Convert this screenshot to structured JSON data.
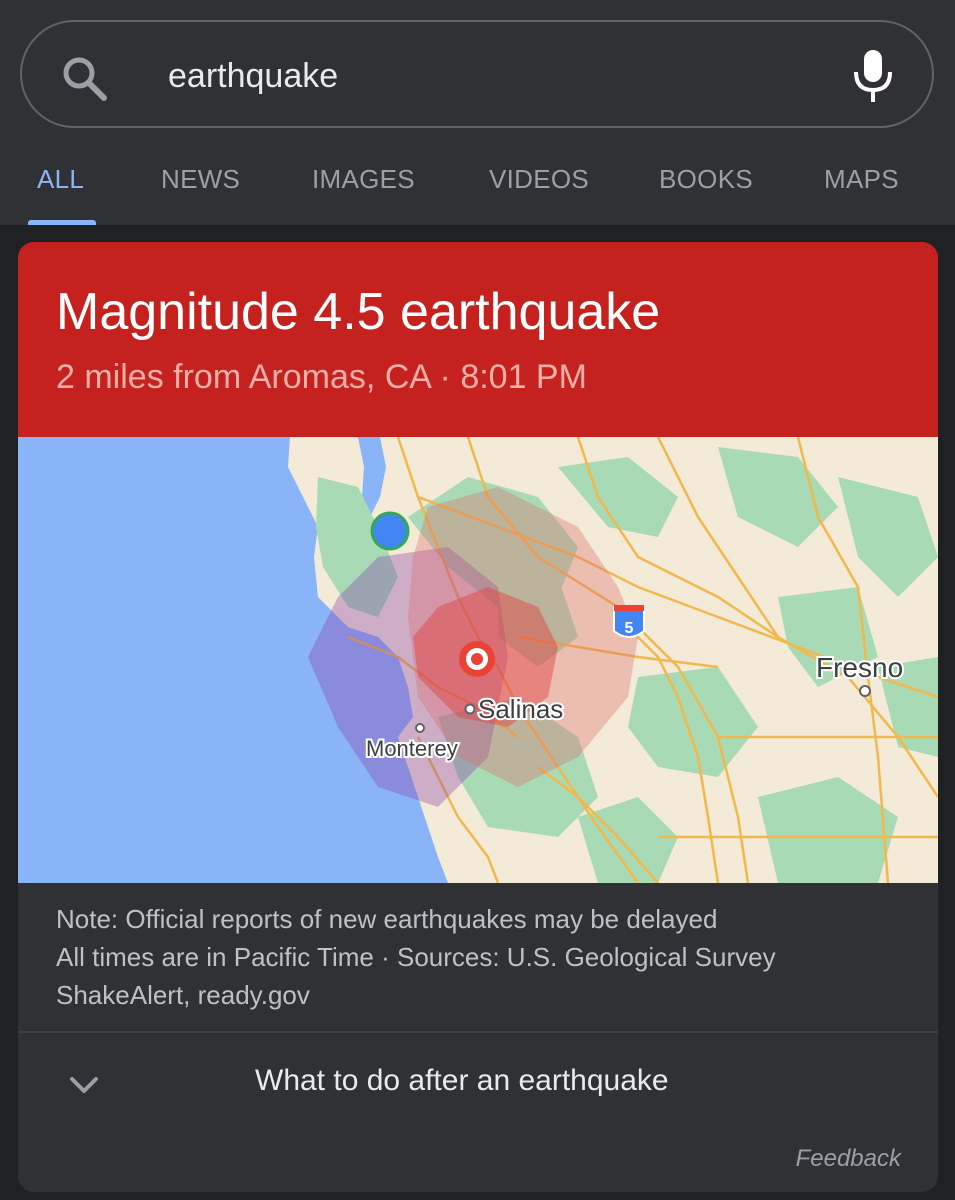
{
  "search": {
    "query": "earthquake",
    "search_icon": "search-icon",
    "mic_icon": "microphone-icon"
  },
  "tabs": [
    {
      "label": "ALL",
      "active": true
    },
    {
      "label": "NEWS",
      "active": false
    },
    {
      "label": "IMAGES",
      "active": false
    },
    {
      "label": "VIDEOS",
      "active": false
    },
    {
      "label": "BOOKS",
      "active": false
    },
    {
      "label": "MAPS",
      "active": false
    }
  ],
  "quake": {
    "title": "Magnitude 4.5 earthquake",
    "subtitle": "2 miles from Aromas, CA · 8:01 PM",
    "banner_color": "#c5221f"
  },
  "map": {
    "labels": {
      "salinas": "Salinas",
      "monterey": "Monterey",
      "fresno": "Fresno",
      "highway": "5"
    },
    "ocean_color": "#8ab4f8",
    "epicenter_color": "#ea4335",
    "user_location_color": "#4285f4"
  },
  "notes": {
    "line1": "Note: Official reports of new earthquakes may be delayed",
    "line2": "All times are in Pacific Time · Sources: U.S. Geological Survey",
    "line3": "ShakeAlert, ready.gov"
  },
  "expander": {
    "label": "What to do after an earthquake",
    "icon": "chevron-down-icon"
  },
  "feedback": "Feedback"
}
